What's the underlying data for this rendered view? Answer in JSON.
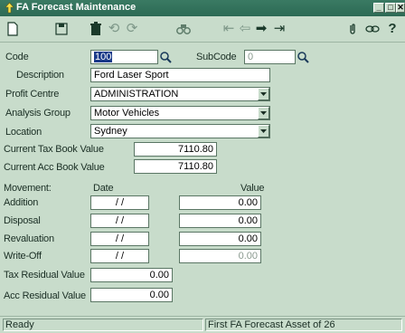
{
  "window": {
    "title": "FA Forecast Maintenance",
    "controls": [
      "_",
      "□",
      "✕"
    ]
  },
  "toolbar": {
    "icons": [
      "new-icon",
      "save-icon",
      "delete-icon",
      "undo-icon",
      "refresh-icon",
      "find-icon",
      "first-icon",
      "previous-icon",
      "next-icon",
      "last-icon",
      "attach-icon",
      "link-icon",
      "help-icon"
    ]
  },
  "form": {
    "code_label": "Code",
    "code_value": "100",
    "subcode_label": "SubCode",
    "subcode_value": "0",
    "description_label": "Description",
    "description_value": "Ford Laser Sport",
    "profit_centre_label": "Profit Centre",
    "profit_centre_value": "ADMINISTRATION",
    "analysis_group_label": "Analysis Group",
    "analysis_group_value": "Motor Vehicles",
    "location_label": "Location",
    "location_value": "Sydney",
    "tax_book_label": "Current Tax Book Value",
    "tax_book_value": "7110.80",
    "acc_book_label": "Current Acc Book Value",
    "acc_book_value": "7110.80",
    "movement_header": "Movement:",
    "date_header": "Date",
    "value_header": "Value",
    "movements": [
      {
        "label": "Addition",
        "date": "/ /",
        "value": "0.00"
      },
      {
        "label": "Disposal",
        "date": "/ /",
        "value": "0.00"
      },
      {
        "label": "Revaluation",
        "date": "/ /",
        "value": "0.00"
      },
      {
        "label": "Write-Off",
        "date": "/ /",
        "value": "0.00"
      }
    ],
    "tax_residual_label": "Tax Residual Value",
    "tax_residual_value": "0.00",
    "acc_residual_label": "Acc Residual Value",
    "acc_residual_value": "0.00"
  },
  "status": {
    "left": "Ready",
    "right": "First FA Forecast Asset of 26"
  }
}
